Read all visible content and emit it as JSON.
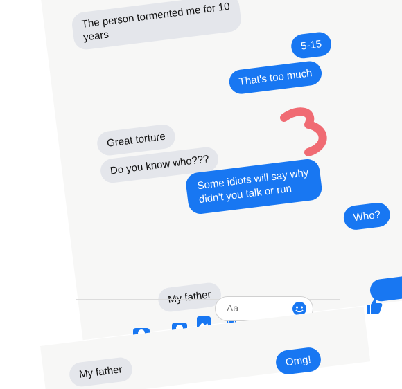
{
  "messages": [
    {
      "side": "in",
      "text": "The person tormented me for 10"
    },
    {
      "side": "in",
      "text": "years"
    },
    {
      "side": "out",
      "text": "5-15"
    },
    {
      "side": "out",
      "text": "That's too much"
    },
    {
      "side": "in",
      "text": "Great torture"
    },
    {
      "side": "in",
      "text": "Do you know who???"
    },
    {
      "side": "out",
      "text": "Some idiots will say why"
    },
    {
      "side": "out",
      "text": "didn't you talk or run"
    },
    {
      "side": "out",
      "text": "Who?"
    },
    {
      "side": "in",
      "text": "My father"
    }
  ],
  "composer": {
    "placeholder": "Aa"
  },
  "bottom": {
    "in_text": "My father",
    "out_text": "Omg!"
  },
  "colors": {
    "outgoing": "#1877f2",
    "incoming": "#e4e6eb",
    "annotation": "#f06b73"
  },
  "icons": [
    "camera-icon",
    "image-icon",
    "microphone-icon",
    "emoji-icon",
    "thumbs-up-icon"
  ]
}
